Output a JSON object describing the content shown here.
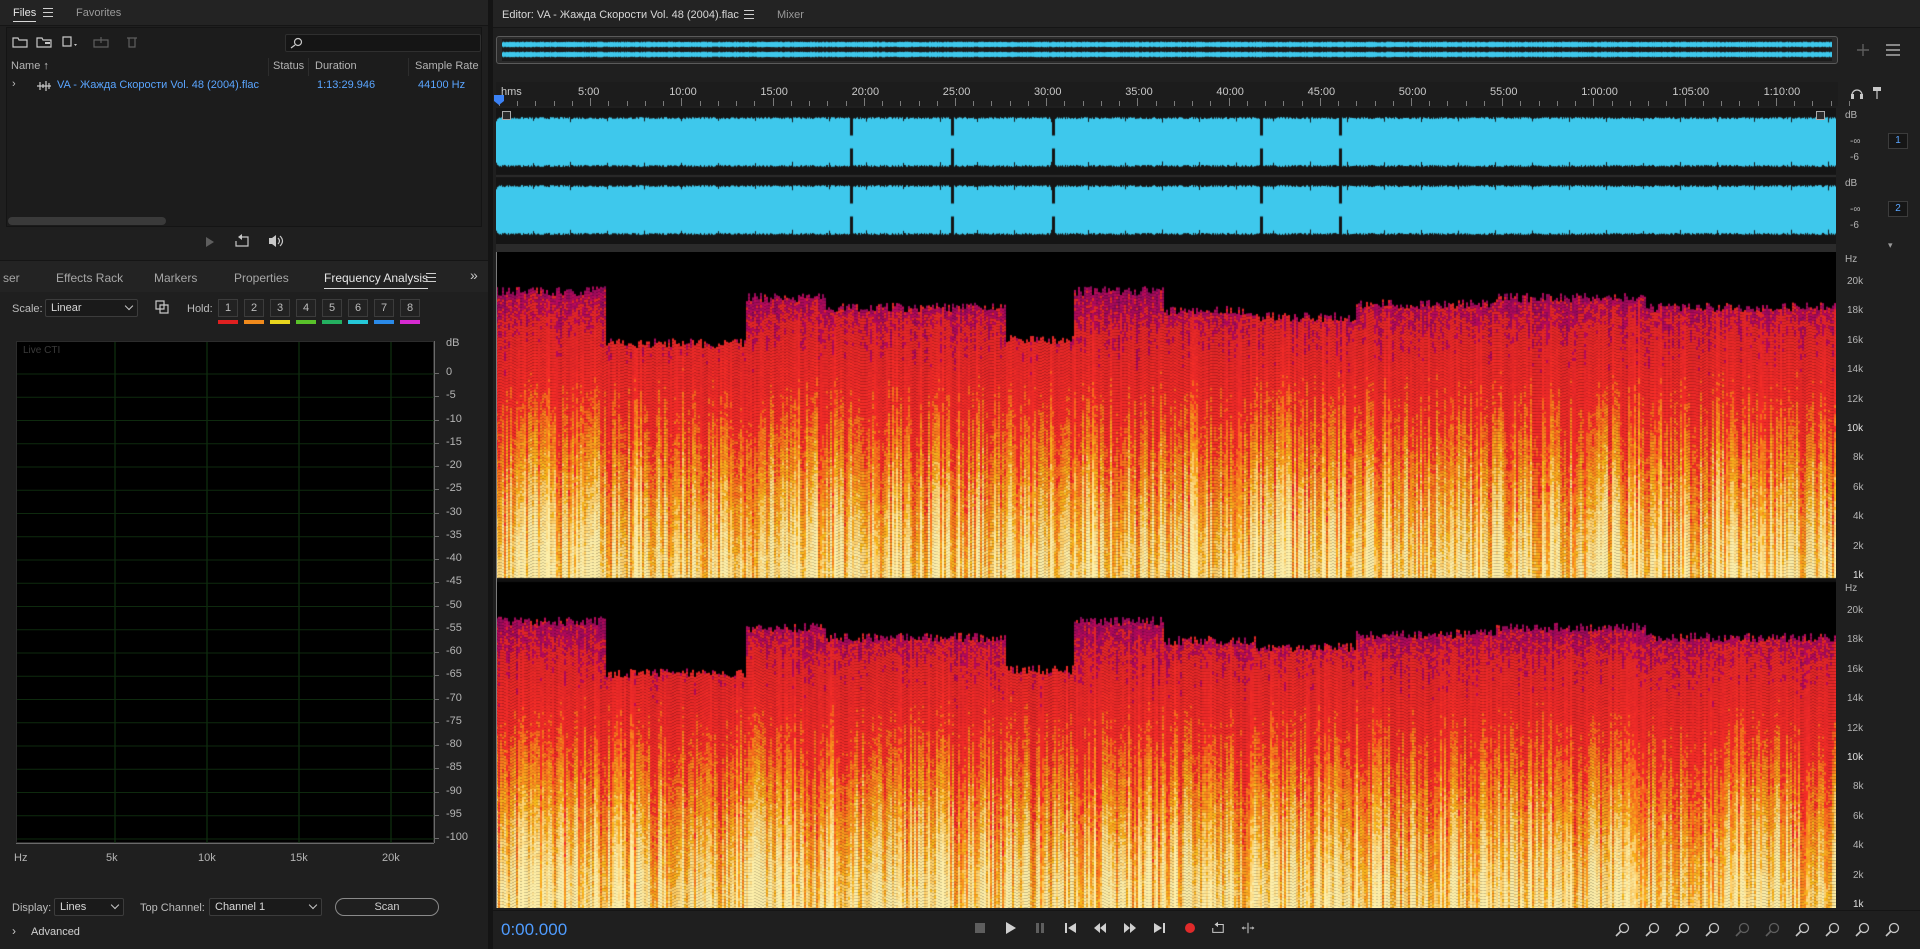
{
  "files_panel": {
    "tab_files": "Files",
    "tab_favorites": "Favorites",
    "columns": {
      "name": "Name",
      "status": "Status",
      "duration": "Duration",
      "sample_rate": "Sample Rate"
    },
    "file": {
      "name": "VA - Жажда Скорости Vol. 48 (2004).flac",
      "duration": "1:13:29.946",
      "sample_rate": "44100 Hz"
    }
  },
  "analysis_panel": {
    "tabs": [
      "ser",
      "Effects Rack",
      "Markers",
      "Properties",
      "Frequency Analysis"
    ],
    "scale_label": "Scale:",
    "scale_value": "Linear",
    "hold_label": "Hold:",
    "hold_buttons": [
      "1",
      "2",
      "3",
      "4",
      "5",
      "6",
      "7",
      "8"
    ],
    "hold_colors": [
      "#e02020",
      "#f08a1c",
      "#e8d51e",
      "#59c12a",
      "#24b060",
      "#25c8d8",
      "#2a8ae8",
      "#d62ad0"
    ],
    "live_label": "Live CTI",
    "db_unit": "dB",
    "db_ticks": [
      "0",
      "-5",
      "-10",
      "-15",
      "-20",
      "-25",
      "-30",
      "-35",
      "-40",
      "-45",
      "-50",
      "-55",
      "-60",
      "-65",
      "-70",
      "-75",
      "-80",
      "-85",
      "-90",
      "-95",
      "-100"
    ],
    "hz_ticks": [
      "Hz",
      "5k",
      "10k",
      "15k",
      "20k"
    ],
    "display_label": "Display:",
    "display_value": "Lines",
    "top_channel_label": "Top Channel:",
    "top_channel_value": "Channel 1",
    "scan_label": "Scan",
    "advanced_label": "Advanced"
  },
  "editor": {
    "tab_title": "Editor: VA - Жажда Скорости Vol. 48 (2004).flac",
    "tab_mixer": "Mixer",
    "ruler_unit": "hms",
    "ruler_labels": [
      "5:00",
      "10:00",
      "15:00",
      "20:00",
      "25:00",
      "30:00",
      "35:00",
      "40:00",
      "45:00",
      "50:00",
      "55:00",
      "1:00:00",
      "1:05:00",
      "1:10:00"
    ],
    "wave_db_unit": "dB",
    "wave_db_ticks": [
      "-∞",
      "-6"
    ],
    "channel_1": "1",
    "channel_2": "2",
    "spec_unit": "Hz",
    "spec_ticks": [
      "20k",
      "18k",
      "16k",
      "14k",
      "12k",
      "10k",
      "8k",
      "6k",
      "4k",
      "2k",
      "1k"
    ],
    "timecode": "0:00.000",
    "colors": {
      "waveform": "#3ec8ec",
      "accent": "#4f9cff",
      "record": "#e02a2a"
    }
  }
}
